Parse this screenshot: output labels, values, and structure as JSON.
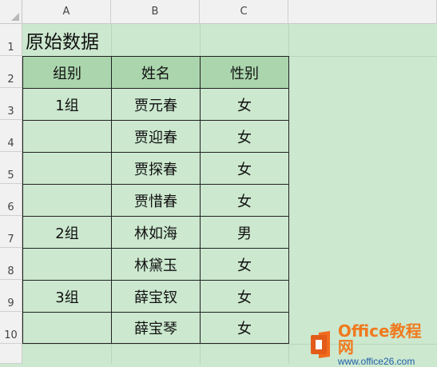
{
  "columns": [
    "A",
    "B",
    "C"
  ],
  "rows": [
    "1",
    "2",
    "3",
    "4",
    "5",
    "6",
    "7",
    "8",
    "9",
    "10"
  ],
  "title": "原始数据",
  "table": {
    "headers": [
      "组别",
      "姓名",
      "性别"
    ],
    "groups": [
      {
        "group": "1组",
        "names": [
          "贾元春",
          "贾迎春",
          "贾探春",
          "贾惜春"
        ],
        "genders": [
          "女",
          "女",
          "女",
          "女"
        ]
      },
      {
        "group": "2组",
        "names": [
          "林如海",
          "林黛玉"
        ],
        "genders": [
          "男",
          "女"
        ]
      },
      {
        "group": "3组",
        "names": [
          "薛宝钗",
          "薛宝琴"
        ],
        "genders": [
          "女",
          "女"
        ]
      }
    ]
  },
  "logo": {
    "brand": "Office教程网",
    "url": "www.office26.com"
  },
  "colors": {
    "background": "#cce8cf",
    "header_fill": "#abd6ad",
    "logo_orange": "#f07a1e",
    "logo_blue": "#1f5fa8"
  }
}
